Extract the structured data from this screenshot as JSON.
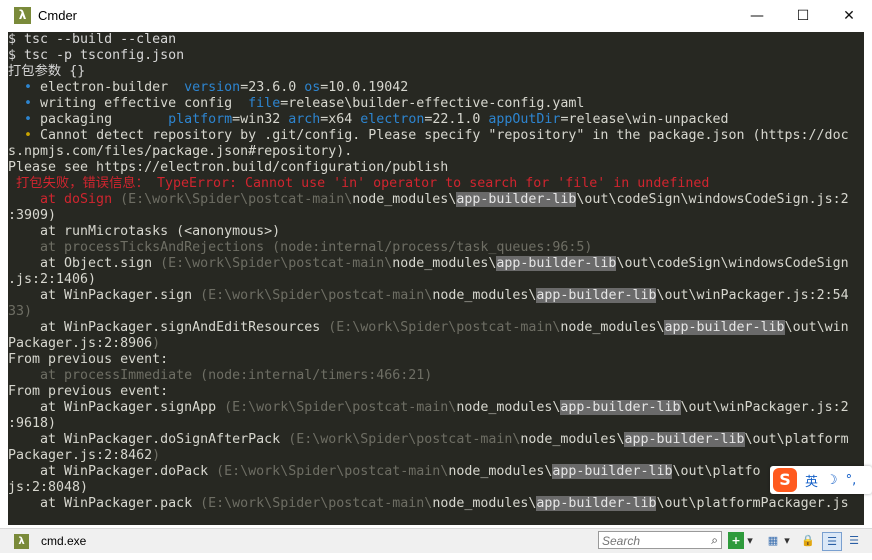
{
  "window": {
    "title": "Cmder",
    "app_icon_glyph": "λ",
    "minimize_glyph": "—",
    "maximize_glyph": "☐",
    "close_glyph": "✕"
  },
  "terminal": {
    "lines": [
      [
        {
          "t": "$ tsc --build --clean",
          "c": "c-cmd"
        }
      ],
      [
        {
          "t": "$ tsc -p tsconfig.json",
          "c": "c-cmd"
        }
      ],
      [
        {
          "t": "打包参数 {}",
          "c": "c-cjk"
        }
      ],
      [
        {
          "t": "  • ",
          "c": "c-blue"
        },
        {
          "t": "electron-builder  ",
          "c": "c-white"
        },
        {
          "t": "version",
          "c": "c-key"
        },
        {
          "t": "=23.6.0 ",
          "c": "c-white"
        },
        {
          "t": "os",
          "c": "c-key"
        },
        {
          "t": "=10.0.19042",
          "c": "c-white"
        }
      ],
      [
        {
          "t": "  • ",
          "c": "c-blue"
        },
        {
          "t": "writing effective config  ",
          "c": "c-white"
        },
        {
          "t": "file",
          "c": "c-key"
        },
        {
          "t": "=release\\builder-effective-config.yaml",
          "c": "c-white"
        }
      ],
      [
        {
          "t": "  • ",
          "c": "c-blue"
        },
        {
          "t": "packaging       ",
          "c": "c-white"
        },
        {
          "t": "platform",
          "c": "c-key"
        },
        {
          "t": "=win32 ",
          "c": "c-white"
        },
        {
          "t": "arch",
          "c": "c-key"
        },
        {
          "t": "=x64 ",
          "c": "c-white"
        },
        {
          "t": "electron",
          "c": "c-key"
        },
        {
          "t": "=22.1.0 ",
          "c": "c-white"
        },
        {
          "t": "appOutDir",
          "c": "c-key"
        },
        {
          "t": "=release\\win-unpacked",
          "c": "c-white"
        }
      ],
      [
        {
          "t": "  • ",
          "c": "c-yel"
        },
        {
          "t": "Cannot detect repository by .git/config. Please specify \"repository\" in the package.json (https://doc",
          "c": "c-white"
        }
      ],
      [
        {
          "t": "s.npmjs.com/files/package.json#repository).",
          "c": "c-white"
        }
      ],
      [
        {
          "t": "Please see https://electron.build/configuration/publish",
          "c": "c-white"
        }
      ],
      [
        {
          "t": " 打包失败，错误信息： TypeError: Cannot use 'in' operator to search for 'file' in undefined",
          "c": "c-red"
        }
      ],
      [
        {
          "t": "    at doSign ",
          "c": "c-red"
        },
        {
          "t": "(E:\\work\\Spider\\postcat-main\\",
          "c": "c-dim"
        },
        {
          "t": "node_modules\\",
          "c": "c-white"
        },
        {
          "t": "app-builder-lib",
          "c": "c-hl"
        },
        {
          "t": "\\out\\codeSign\\windowsCodeSign.js:2",
          "c": "c-white"
        }
      ],
      [
        {
          "t": ":3909)",
          "c": "c-white"
        }
      ],
      [
        {
          "t": "    at runMicrotasks (<anonymous>)",
          "c": "c-white"
        }
      ],
      [
        {
          "t": "    at processTicksAndRejections (node:internal/process/task_queues:96:5)",
          "c": "c-dim"
        }
      ],
      [
        {
          "t": "    at Object.sign ",
          "c": "c-white"
        },
        {
          "t": "(E:\\work\\Spider\\postcat-main\\",
          "c": "c-dim"
        },
        {
          "t": "node_modules\\",
          "c": "c-white"
        },
        {
          "t": "app-builder-lib",
          "c": "c-hl"
        },
        {
          "t": "\\out\\codeSign\\windowsCodeSign",
          "c": "c-white"
        }
      ],
      [
        {
          "t": ".js:2:1406)",
          "c": "c-white"
        }
      ],
      [
        {
          "t": "    at WinPackager.sign ",
          "c": "c-white"
        },
        {
          "t": "(E:\\work\\Spider\\postcat-main\\",
          "c": "c-dim"
        },
        {
          "t": "node_modules\\",
          "c": "c-white"
        },
        {
          "t": "app-builder-lib",
          "c": "c-hl"
        },
        {
          "t": "\\out\\winPackager.js:2:54",
          "c": "c-white"
        }
      ],
      [
        {
          "t": "33)",
          "c": "c-dim"
        }
      ],
      [
        {
          "t": "    at WinPackager.signAndEditResources ",
          "c": "c-white"
        },
        {
          "t": "(E:\\work\\Spider\\postcat-main\\",
          "c": "c-dim"
        },
        {
          "t": "node_modules\\",
          "c": "c-white"
        },
        {
          "t": "app-builder-lib",
          "c": "c-hl"
        },
        {
          "t": "\\out\\win",
          "c": "c-white"
        }
      ],
      [
        {
          "t": "Packager.js:2:8906",
          "c": "c-white"
        },
        {
          "t": ")",
          "c": "c-dim"
        }
      ],
      [
        {
          "t": "From previous event:",
          "c": "c-white"
        }
      ],
      [
        {
          "t": "    at processImmediate (node:internal/timers:466:21)",
          "c": "c-dim"
        }
      ],
      [
        {
          "t": "From previous event:",
          "c": "c-white"
        }
      ],
      [
        {
          "t": "    at WinPackager.signApp ",
          "c": "c-white"
        },
        {
          "t": "(E:\\work\\Spider\\postcat-main\\",
          "c": "c-dim"
        },
        {
          "t": "node_modules\\",
          "c": "c-white"
        },
        {
          "t": "app-builder-lib",
          "c": "c-hl"
        },
        {
          "t": "\\out\\winPackager.js:2",
          "c": "c-white"
        }
      ],
      [
        {
          "t": ":9618)",
          "c": "c-white"
        }
      ],
      [
        {
          "t": "    at WinPackager.doSignAfterPack ",
          "c": "c-white"
        },
        {
          "t": "(E:\\work\\Spider\\postcat-main\\",
          "c": "c-dim"
        },
        {
          "t": "node_modules\\",
          "c": "c-white"
        },
        {
          "t": "app-builder-lib",
          "c": "c-hl"
        },
        {
          "t": "\\out\\platform",
          "c": "c-white"
        }
      ],
      [
        {
          "t": "Packager.js:2:8462",
          "c": "c-white"
        },
        {
          "t": ")",
          "c": "c-dim"
        }
      ],
      [
        {
          "t": "    at WinPackager.doPack ",
          "c": "c-white"
        },
        {
          "t": "(E:\\work\\Spider\\postcat-main\\",
          "c": "c-dim"
        },
        {
          "t": "node_modules\\",
          "c": "c-white"
        },
        {
          "t": "app-builder-lib",
          "c": "c-hl"
        },
        {
          "t": "\\out\\platfo",
          "c": "c-white"
        }
      ],
      [
        {
          "t": "js:2:8048)",
          "c": "c-white"
        }
      ],
      [
        {
          "t": "    at WinPackager.pack ",
          "c": "c-white"
        },
        {
          "t": "(E:\\work\\Spider\\postcat-main\\",
          "c": "c-dim"
        },
        {
          "t": "node_modules\\",
          "c": "c-white"
        },
        {
          "t": "app-builder-lib",
          "c": "c-hl"
        },
        {
          "t": "\\out\\platformPackager.js",
          "c": "c-white"
        }
      ]
    ]
  },
  "statusbar": {
    "tab_label": "cmd.exe",
    "tab_icon_glyph": "λ",
    "search_placeholder": "Search",
    "search_icon_glyph": "⌕",
    "new_console_glyph": "+",
    "dropdown_glyph": "▾",
    "panes_glyph": "▦",
    "lock_glyph": "🔒",
    "list_glyph": "☰"
  },
  "ime": {
    "logo": "S",
    "lang": "英",
    "moon": "☽",
    "punct": "°,"
  },
  "colors": {
    "terminal_bg": "#272822",
    "info_bullet": "#2d85d0",
    "warning_bullet": "#c9a400",
    "error": "#d0252f",
    "highlight": "#6a6a6a"
  }
}
